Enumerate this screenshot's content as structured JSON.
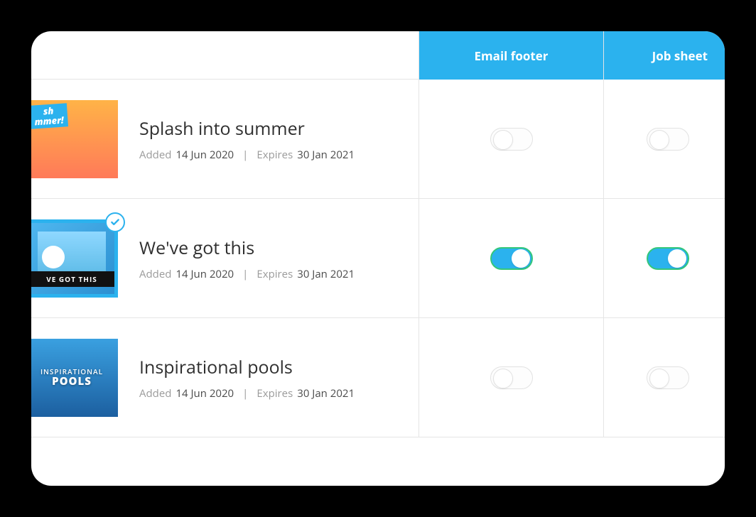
{
  "columns": {
    "email_footer": "Email footer",
    "job_sheet": "Job sheet"
  },
  "meta_labels": {
    "added": "Added",
    "expires": "Expires"
  },
  "rows": [
    {
      "title": "Splash into summer",
      "added": "14 Jun 2020",
      "expires": "30 Jan 2021",
      "selected": false,
      "thumb_text_line1": "sh",
      "thumb_text_line2": "mmer!",
      "email_footer": false,
      "job_sheet": false
    },
    {
      "title": "We've got this",
      "added": "14 Jun 2020",
      "expires": "30 Jan 2021",
      "selected": true,
      "thumb_caption": "VE GOT THIS",
      "email_footer": true,
      "job_sheet": true
    },
    {
      "title": "Inspirational pools",
      "added": "14 Jun 2020",
      "expires": "30 Jan 2021",
      "selected": false,
      "thumb_caption_small": "INSPIRATIONAL",
      "thumb_caption_big": "POOLS",
      "email_footer": false,
      "job_sheet": false
    }
  ]
}
